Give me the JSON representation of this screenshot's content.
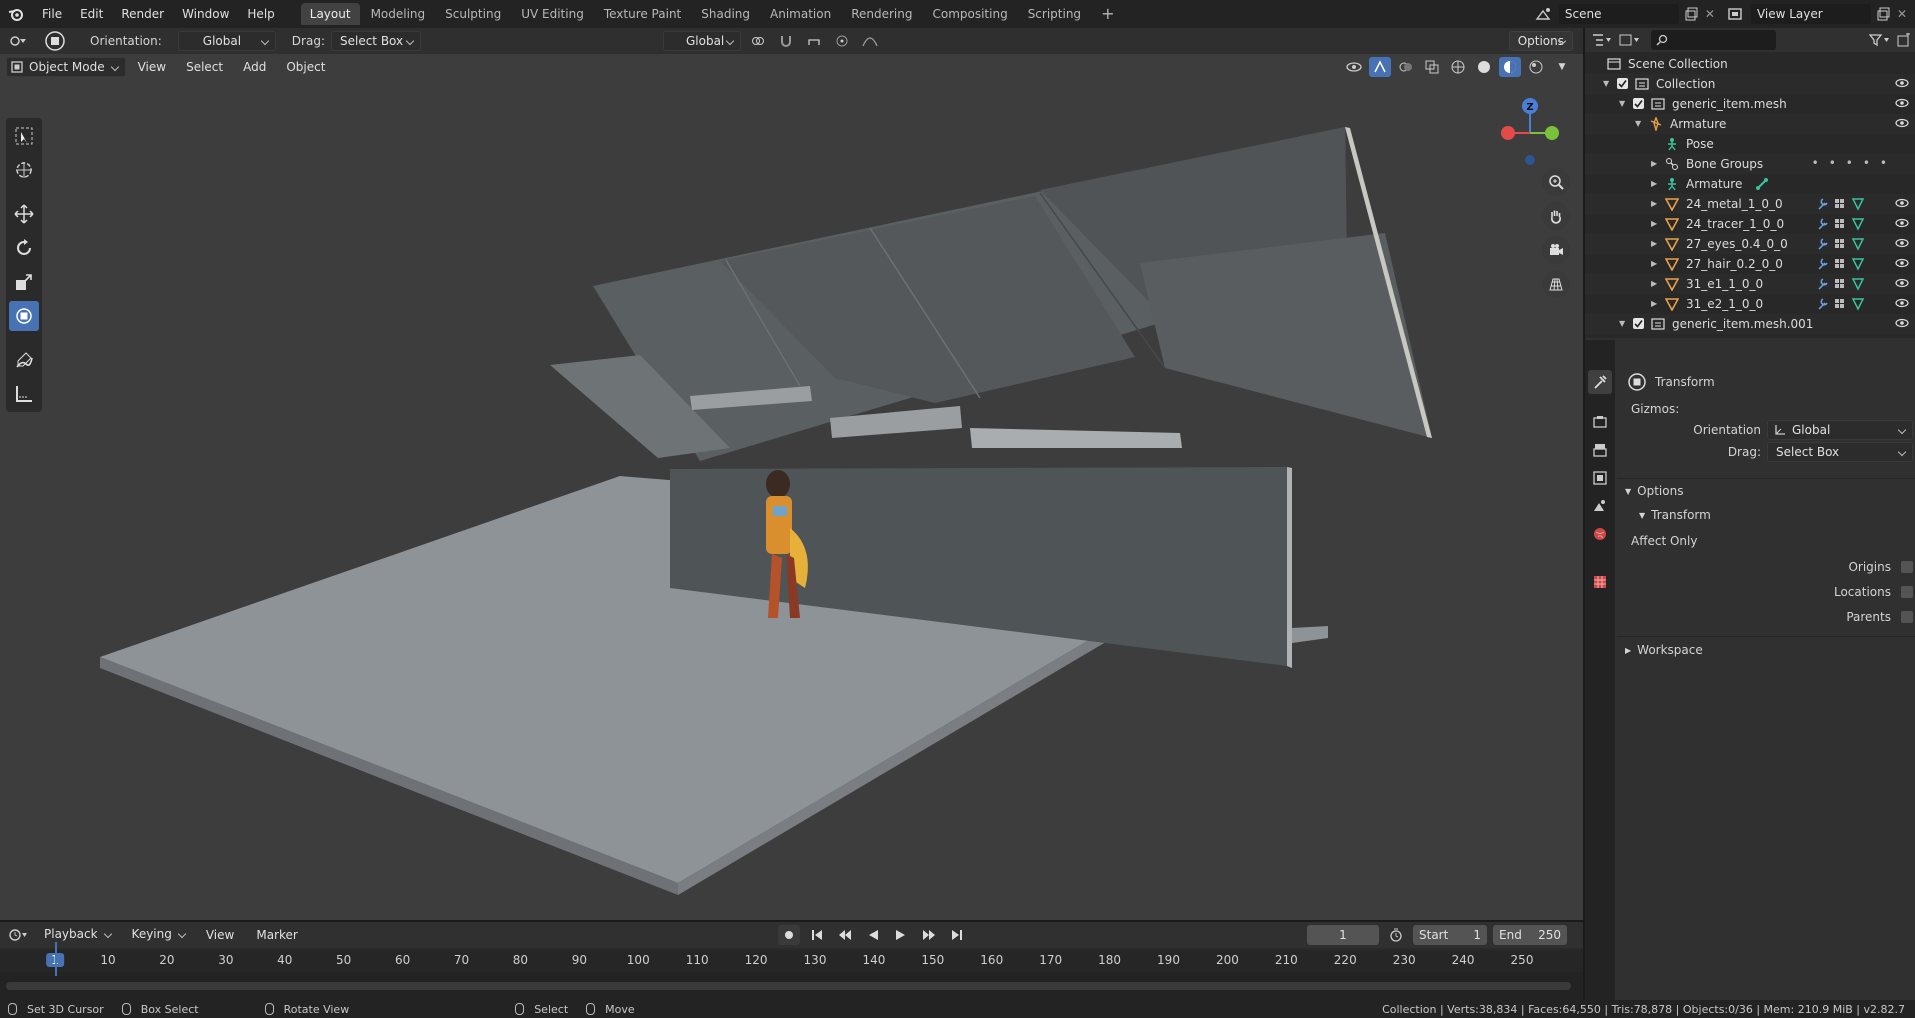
{
  "topbar": {
    "menus": [
      "File",
      "Edit",
      "Render",
      "Window",
      "Help"
    ],
    "workspace_tabs": [
      "Layout",
      "Modeling",
      "Sculpting",
      "UV Editing",
      "Texture Paint",
      "Shading",
      "Animation",
      "Rendering",
      "Compositing",
      "Scripting"
    ],
    "active_tab": "Layout",
    "scene_name": "Scene",
    "view_layer": "View Layer"
  },
  "tool_header": {
    "orientation_label": "Orientation:",
    "orientation_value": "Global",
    "drag_label": "Drag:",
    "drag_value": "Select Box",
    "transform_orientation": "Global",
    "options_label": "Options"
  },
  "viewport_header": {
    "mode": "Object Mode",
    "menus": [
      "View",
      "Select",
      "Add",
      "Object"
    ]
  },
  "gizmo": {
    "z_label": "Z"
  },
  "outliner": {
    "search_placeholder": "",
    "rows": [
      {
        "label": "Scene Collection",
        "icon": "scene-collection-icon",
        "eye": false
      },
      {
        "label": "Collection",
        "icon": "collection-icon",
        "eye": true
      },
      {
        "label": "generic_item.mesh",
        "icon": "collection-icon",
        "eye": true
      },
      {
        "label": "Armature",
        "icon": "armature-icon",
        "eye": true
      },
      {
        "label": "Pose",
        "icon": "pose-icon",
        "eye": false
      },
      {
        "label": "Bone Groups",
        "icon": "bone-groups-icon",
        "eye": false
      },
      {
        "label": "Armature",
        "icon": "armature-data-icon",
        "eye": false
      },
      {
        "label": "24_metal_1_0_0",
        "icon": "mesh-icon",
        "eye": true
      },
      {
        "label": "24_tracer_1_0_0",
        "icon": "mesh-icon",
        "eye": true
      },
      {
        "label": "27_eyes_0.4_0_0",
        "icon": "mesh-icon",
        "eye": true
      },
      {
        "label": "27_hair_0.2_0_0",
        "icon": "mesh-icon",
        "eye": true
      },
      {
        "label": "31_e1_1_0_0",
        "icon": "mesh-icon",
        "eye": true
      },
      {
        "label": "31_e2_1_0_0",
        "icon": "mesh-icon",
        "eye": true
      },
      {
        "label": "generic_item.mesh.001",
        "icon": "collection-icon",
        "eye": true
      }
    ]
  },
  "properties": {
    "panel_title": "Transform",
    "gizmos_label": "Gizmos:",
    "orientation_label": "Orientation",
    "orientation_value": "Global",
    "drag_label": "Drag:",
    "drag_value": "Select Box",
    "options_label": "Options",
    "transform_sub": "Transform",
    "affect_only": "Affect Only",
    "origins": "Origins",
    "locations": "Locations",
    "parents": "Parents",
    "workspace": "Workspace"
  },
  "timeline": {
    "menus": [
      "Playback",
      "Keying",
      "View",
      "Marker"
    ],
    "current_frame": "1",
    "start_label": "Start",
    "start_value": "1",
    "end_label": "End",
    "end_value": "250",
    "ticks": [
      "1",
      "10",
      "20",
      "30",
      "40",
      "50",
      "60",
      "70",
      "80",
      "90",
      "100",
      "110",
      "120",
      "130",
      "140",
      "150",
      "160",
      "170",
      "180",
      "190",
      "200",
      "210",
      "220",
      "230",
      "240",
      "250"
    ]
  },
  "status": {
    "left1": "Set 3D Cursor",
    "left2": "Box Select",
    "left3": "Rotate View",
    "left4": "Select",
    "left5": "Move",
    "right": "Collection | Verts:38,834 | Faces:64,550 | Tris:78,878 | Objects:0/36 | Mem: 210.9 MiB | v2.82.7"
  },
  "colors": {
    "accent": "#4772b3",
    "viewport_bg": "#3d3d3d",
    "mesh_orange": "#e08a3a",
    "gizmo_x": "#e54a4a",
    "gizmo_y": "#7ac23c",
    "gizmo_z": "#4a7fd9"
  }
}
